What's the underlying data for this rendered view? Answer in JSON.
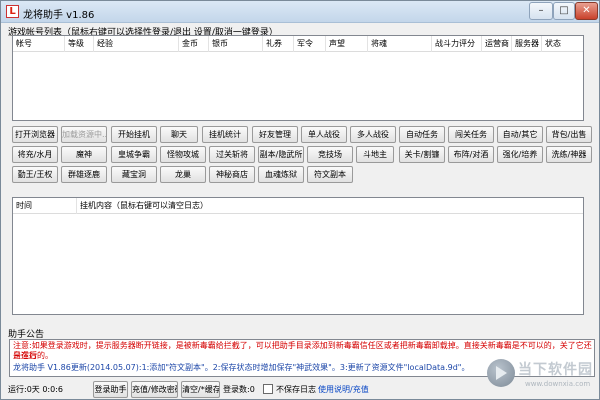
{
  "window": {
    "app_icon_letter": "L",
    "title": "龙将助手 v1.86",
    "minimize_glyph": "–",
    "maximize_glyph": "□",
    "close_glyph": "✕"
  },
  "accounts": {
    "label": "游戏帐号列表（鼠标右键可以选择性登录/退出 设置/取消一键登录）",
    "columns": [
      "帐号",
      "等级",
      "经验",
      "金币",
      "银币",
      "礼券",
      "军令",
      "声望",
      "将魂",
      "战斗力评分",
      "运营商",
      "服务器",
      "状态"
    ]
  },
  "buttons": [
    [
      {
        "name": "open-browser-button",
        "label": "打开浏览器"
      },
      {
        "name": "load-resources-button",
        "label": "加载资源中...",
        "disabled": true
      },
      {
        "name": "start-hangup-button",
        "label": "开始挂机"
      },
      {
        "name": "chat-button",
        "label": "聊天"
      },
      {
        "name": "hangup-stats-button",
        "label": "挂机统计"
      },
      {
        "name": "friend-manage-button",
        "label": "好友管理"
      },
      {
        "name": "single-battle-button",
        "label": "单人战役"
      },
      {
        "name": "multi-battle-button",
        "label": "多人战役"
      },
      {
        "name": "auto-task-button",
        "label": "自动任务"
      },
      {
        "name": "pass-task-button",
        "label": "闯关任务"
      },
      {
        "name": "auto-other-button",
        "label": "自动/其它"
      },
      {
        "name": "backpack-sell-button",
        "label": "背包/出售"
      }
    ],
    [
      {
        "name": "general-soul-button",
        "label": "将充/水月"
      },
      {
        "name": "demon-god-button",
        "label": "魔神"
      },
      {
        "name": "imperial-city-button",
        "label": "皇城争霸"
      },
      {
        "name": "monster-siege-button",
        "label": "怪物攻城"
      },
      {
        "name": "pass-kill-button",
        "label": "过关斩将"
      },
      {
        "name": "dungeon-martial-button",
        "label": "副本/隐武所"
      },
      {
        "name": "arena-button",
        "label": "竞技场"
      },
      {
        "name": "landlord-button",
        "label": "斗地主"
      },
      {
        "name": "card-scrape-button",
        "label": "关卡/割镰"
      },
      {
        "name": "formation-duel-button",
        "label": "布阵/对酒"
      },
      {
        "name": "strengthen-cultivate-button",
        "label": "强化/培养"
      },
      {
        "name": "wash-artifact-button",
        "label": "洗练/神器"
      }
    ],
    [
      {
        "name": "king-button",
        "label": "勤王/王权"
      },
      {
        "name": "hero-deer-button",
        "label": "群雄逐鹿"
      },
      {
        "name": "treasure-cave-button",
        "label": "藏宝洞"
      },
      {
        "name": "dragon-nest-button",
        "label": "龙巢"
      },
      {
        "name": "mystery-shop-button",
        "label": "神秘商店"
      },
      {
        "name": "blood-refine-button",
        "label": "血魂炼狱"
      },
      {
        "name": "rune-dungeon-button",
        "label": "符文副本"
      }
    ]
  ],
  "log": {
    "columns": [
      "时间",
      "挂机内容（鼠标右键可以清空日志）"
    ]
  },
  "notice": {
    "label": "助手公告",
    "line1": "注意:如果登录游戏时，提示服务器断开链接，是被新毒霸给拦截了，可以把助手目录添加到新毒霸信任区或者把新毒霸卸载掉。直接关新毒霸是不可以的，关了它还是在后",
    "line2": "台运行的。",
    "line3": "龙将助手 V1.86更新(2014.05.07):1:添加\"符文副本\"。2:保存状态时增加保存\"神武效果\"。3:更新了资源文件\"localData.9d\"。"
  },
  "status": {
    "runtime": "运行:0天 0:0:6",
    "login_button": "登录助手",
    "recharge_button": "充值/修改密码",
    "save_state_button": "清空/*缓存",
    "login_count": "登录数:0",
    "no_save_log": "不保存日志",
    "help_link": "使用说明/充值"
  },
  "watermark": {
    "title": "当下软件园",
    "url": "www.downxia.com"
  }
}
